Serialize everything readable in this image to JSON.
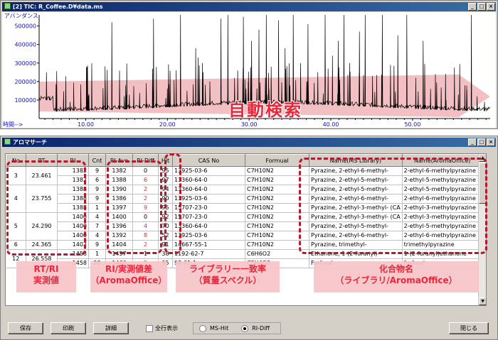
{
  "chart_window": {
    "title": "[2] TIC: R_Coffee.D¥data.ms",
    "y_axis_label": "アバンダンス",
    "x_axis_label": "時間-->",
    "banner": "自動検索"
  },
  "chart_data": {
    "type": "line",
    "series": [
      {
        "name": "",
        "values": []
      }
    ],
    "y_ticks": [
      "500000",
      "400000",
      "300000",
      "200000",
      "100000"
    ],
    "x_ticks": [
      "10.00",
      "20.00",
      "30.00",
      "40.00",
      "50.00"
    ],
    "xlim": [
      4.3,
      59.5
    ],
    "ylim": [
      0,
      560000
    ],
    "grid": false
  },
  "result_window": {
    "title": "アロマサーチ",
    "columns": [
      "No",
      "RT",
      "RI",
      "Cnt",
      "RI-Ave",
      "RI-Diff",
      "Hit",
      "CAS No",
      "Formual",
      "Name(MS Library)",
      "Name(AromaOffice)"
    ],
    "groups": [
      {
        "no": "3",
        "rt": "23.461",
        "rows": [
          [
            "1382",
            "9",
            "1382",
            "0",
            "95",
            "13925-03-6",
            "C7H10N2",
            "Pyrazine, 2-ethyl-6-methyl-",
            "2-ethyl-6-methylpyrazine"
          ],
          [
            "1382",
            "6",
            "1388",
            "6",
            "97",
            "13360-64-0",
            "C7H10N2",
            "Pyrazine, 2-ethyl-5-methyl-",
            "2-ethyl-5-methylpyrazine"
          ]
        ]
      },
      {
        "no": "4",
        "rt": "23.755",
        "rows": [
          [
            "1388",
            "9",
            "1390",
            "2",
            "94",
            "13360-64-0",
            "C7H10N2",
            "Pyrazine, 2-ethyl-5-methyl-",
            "2-ethyl-5-methylpyrazine"
          ],
          [
            "1388",
            "9",
            "1386",
            "2",
            "90",
            "13925-03-6",
            "C7H10N2",
            "Pyrazine, 2-ethyl-6-methyl-",
            "2-ethyl-6-methylpyrazine"
          ],
          [
            "1388",
            "1",
            "1397",
            "9",
            "95",
            "15707-23-0",
            "C7H10N2",
            "Pyrazine, 2-ethyl-3-methyl- (CA",
            "2-ethyl-3-methylpyrazine"
          ]
        ]
      },
      {
        "no": "5",
        "rt": "24.290",
        "rows": [
          [
            "1400",
            "4",
            "1400",
            "0",
            "92",
            "15707-23-0",
            "C7H10N2",
            "Pyrazine, 2-ethyl-3-methyl- (CA",
            "2-ethyl-3-methylpyrazine"
          ],
          [
            "1400",
            "7",
            "1396",
            "4",
            "70",
            "13360-64-0",
            "C7H10N2",
            "Pyrazine, 2-ethyl-5-methyl-",
            "2-ethyl-5-methylpyrazine"
          ],
          [
            "1400",
            "4",
            "1392",
            "8",
            "52",
            "13925-03-6",
            "C7H10N2",
            "Pyrazine, 2-ethyl-6-methyl-",
            "2-ethyl-6-methylpyrazine"
          ]
        ]
      },
      {
        "no": "6",
        "rt": "24.365",
        "rows": [
          [
            "1402",
            "9",
            "1404",
            "2",
            "91",
            "14667-55-1",
            "C7H10N2",
            "Pyrazine, trimethyl-",
            "trimethylpyrazine"
          ]
        ]
      },
      {
        "no": "12",
        "rt": "26.558",
        "rows": [
          [
            "1458",
            "1",
            "1457",
            "1",
            "38",
            "1192-62-7",
            "C6H6O2",
            "Ethanone, 1-(2-furanyl)-",
            "1-(2-furanyl)ethanone"
          ],
          [
            "1458",
            "28",
            "1460",
            "2",
            "95",
            "98-01-1",
            "C5H4O2",
            "Furfural",
            "furfural"
          ]
        ]
      }
    ],
    "callouts": {
      "rt_ri": [
        "RT/RI",
        "実測値"
      ],
      "ri_diff": [
        "RI/実測値差",
        "（AromaOffice）"
      ],
      "match": [
        "ライブラリー一致率",
        "（質量スペクル）"
      ],
      "compound": [
        "化合物名",
        "（ライブラリ/AromaOffice）"
      ]
    },
    "partial_row_fragments": {
      "c1": "42",
      "c2": "7",
      "c3": "1",
      "name1": "P",
      "name2": "2",
      "name3": "A"
    },
    "buttons": {
      "save": "保存",
      "print": "印刷",
      "detail": "詳細",
      "show_all": "全行表示",
      "ms_hit": "MS-Hit",
      "ri_diff": "RI-Diff",
      "close": "閉じる"
    }
  },
  "colors": {
    "accent_red": "#e8273a",
    "banner_pink": "#f0b4b9",
    "title_blue": "#0a246a"
  }
}
